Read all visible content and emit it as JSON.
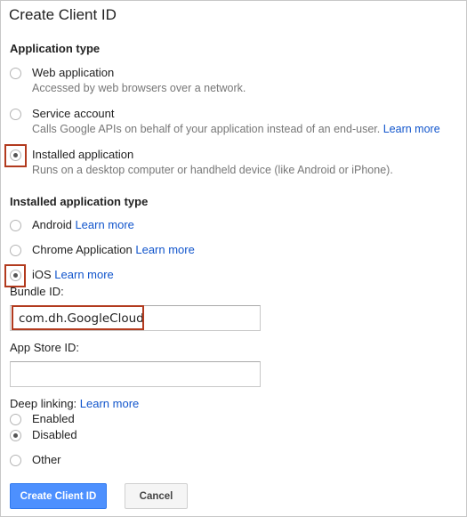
{
  "dialog": {
    "title": "Create Client ID"
  },
  "app_type": {
    "heading": "Application type",
    "options": [
      {
        "label": "Web application",
        "description": "Accessed by web browsers over a network.",
        "selected": false
      },
      {
        "label": "Service account",
        "description": "Calls Google APIs on behalf of your application instead of an end-user.",
        "link": "Learn more",
        "selected": false
      },
      {
        "label": "Installed application",
        "description": "Runs on a desktop computer or handheld device (like Android or iPhone).",
        "selected": true
      }
    ]
  },
  "installed_type": {
    "heading": "Installed application type",
    "options": [
      {
        "label": "Android",
        "link": "Learn more",
        "selected": false
      },
      {
        "label": "Chrome Application",
        "link": "Learn more",
        "selected": false
      },
      {
        "label": "iOS",
        "link": "Learn more",
        "selected": true
      }
    ]
  },
  "bundle_id": {
    "label": "Bundle ID:",
    "value": "com.dh.GoogleCloud"
  },
  "app_store_id": {
    "label": "App Store ID:",
    "value": ""
  },
  "deep_linking": {
    "label": "Deep linking:",
    "link": "Learn more",
    "options": [
      {
        "label": "Enabled",
        "selected": false
      },
      {
        "label": "Disabled",
        "selected": true
      }
    ]
  },
  "other": {
    "label": "Other",
    "selected": false
  },
  "buttons": {
    "create": "Create Client ID",
    "cancel": "Cancel"
  },
  "colors": {
    "link": "#1155cc",
    "primary": "#4d90fe",
    "highlight": "#b23a1e"
  }
}
